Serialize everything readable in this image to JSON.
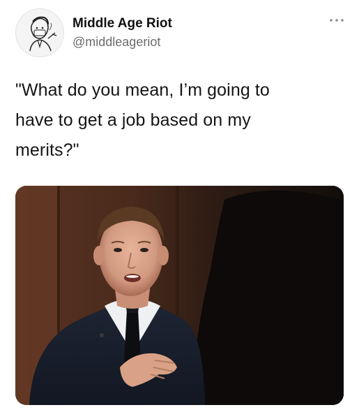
{
  "tweet": {
    "author": {
      "display_name": "Middle Age Riot",
      "handle": "@middleageriot",
      "avatar_icon": "sketch-portrait-avatar"
    },
    "menu_icon": "more-options-icon",
    "text_lines": [
      "\"What do you mean, I’m going to",
      "have to get a job based on my",
      "merits?\""
    ],
    "media": {
      "kind": "photo",
      "description_icon": "man-in-suit-photo"
    }
  }
}
